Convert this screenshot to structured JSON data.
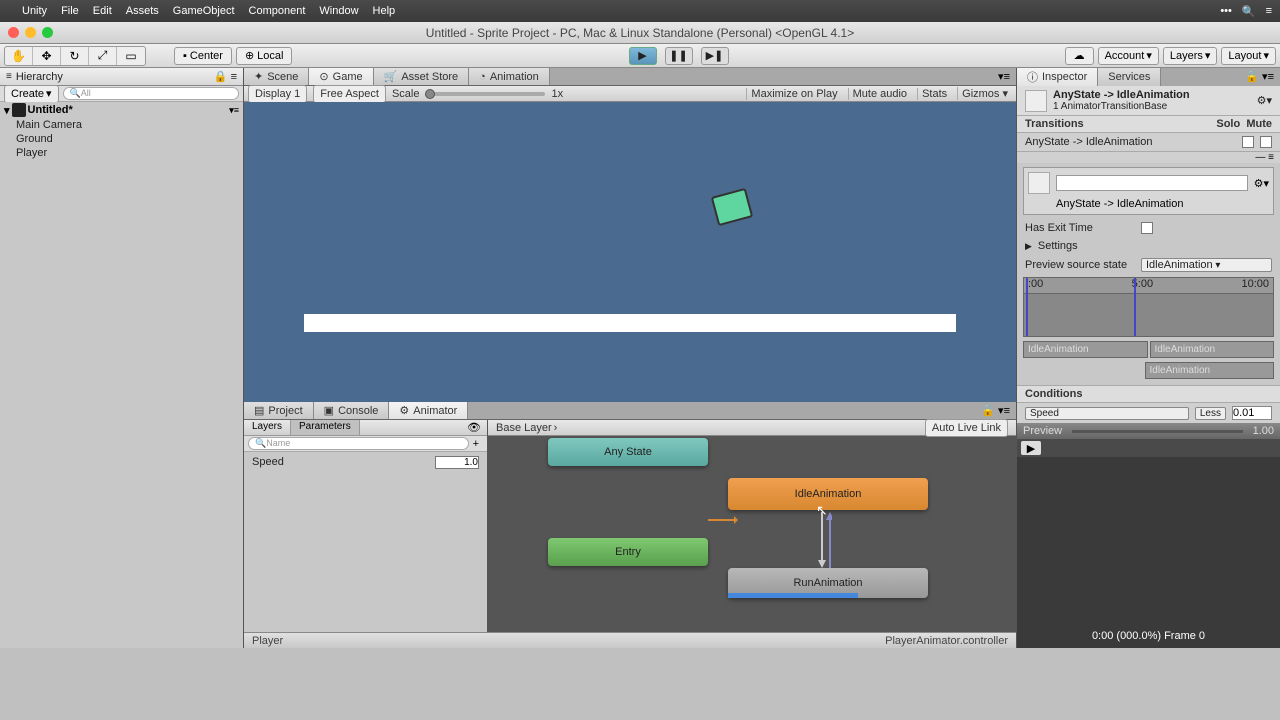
{
  "menubar": {
    "items": [
      "Unity",
      "File",
      "Edit",
      "Assets",
      "GameObject",
      "Component",
      "Window",
      "Help"
    ]
  },
  "title": "Untitled - Sprite Project - PC, Mac & Linux Standalone (Personal) <OpenGL 4.1>",
  "toolbar": {
    "center_label": "Center",
    "local_label": "Local",
    "account": "Account",
    "layers": "Layers",
    "layout": "Layout"
  },
  "hierarchy": {
    "tab": "Hierarchy",
    "create": "Create",
    "root": "Untitled*",
    "items": [
      "Main Camera",
      "Ground",
      "Player"
    ]
  },
  "center_tabs": {
    "scene": "Scene",
    "game": "Game",
    "asset": "Asset Store",
    "anim": "Animation"
  },
  "game_bar": {
    "display": "Display 1",
    "aspect": "Free Aspect",
    "scale": "Scale",
    "scale_val": "1x",
    "maximize": "Maximize on Play",
    "mute": "Mute audio",
    "stats": "Stats",
    "gizmos": "Gizmos"
  },
  "bottom_tabs": {
    "project": "Project",
    "console": "Console",
    "animator": "Animator"
  },
  "animator": {
    "layers": "Layers",
    "parameters": "Parameters",
    "name_ph": "Name",
    "speed_label": "Speed",
    "speed_val": "1.0",
    "base": "Base Layer",
    "auto": "Auto Live Link",
    "nodes": {
      "any": "Any State",
      "idle": "IdleAnimation",
      "entry": "Entry",
      "run": "RunAnimation"
    },
    "status_left": "Player",
    "status_right": "PlayerAnimator.controller"
  },
  "inspector": {
    "tab": "Inspector",
    "services": "Services",
    "title": "AnyState -> IdleAnimation",
    "subtitle": "1 AnimatorTransitionBase",
    "transitions": "Transitions",
    "solo": "Solo",
    "mute": "Mute",
    "trans_item": "AnyState -> IdleAnimation",
    "box_item": "AnyState -> IdleAnimation",
    "exit": "Has Exit Time",
    "settings": "Settings",
    "preview_src": "Preview source state",
    "preview_src_val": "IdleAnimation",
    "t0": ":00",
    "t1": "5:00",
    "t2": "10:00",
    "clip1": "IdleAnimation",
    "clip2": "IdleAnimation",
    "clip3": "IdleAnimation",
    "conditions": "Conditions",
    "cond_param": "Speed",
    "cond_op": "Less",
    "cond_val": "0.01",
    "preview": "Preview",
    "preview_zoom": "1.00",
    "preview_text": "0:00 (000.0%) Frame 0"
  }
}
